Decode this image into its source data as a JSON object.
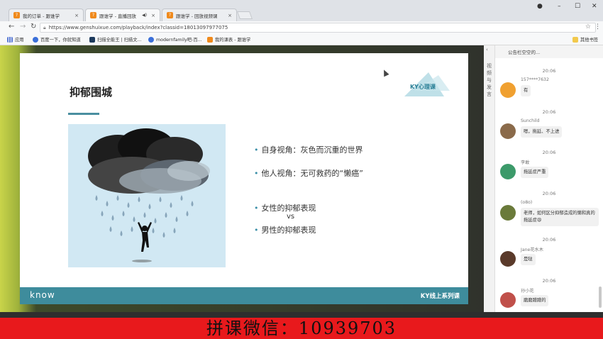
{
  "browser": {
    "tabs": [
      {
        "title": "我的订单 - 跟谁学",
        "active": false
      },
      {
        "title": "跟谁学 - 直播回放",
        "active": true
      },
      {
        "title": "跟谁学 - 回放视频课",
        "active": false
      }
    ],
    "url": "https://www.genshuixue.com/playback/index?classid=18013097977075",
    "bookmarks": [
      {
        "label": "应用",
        "icon": "apps-grid-icon"
      },
      {
        "label": "百度一下，你就知道",
        "icon": "paw-icon"
      },
      {
        "label": "扫描全能王 | 扫描文...",
        "icon": "cs-icon"
      },
      {
        "label": "modernfamily吧-百...",
        "icon": "paw-icon"
      },
      {
        "label": "我的课表 - 跟谁学",
        "icon": "gsx-icon"
      }
    ],
    "other_bookmarks": "其他书签"
  },
  "slide": {
    "title": "抑郁围城",
    "badge": "KY心理课",
    "bullets": [
      "自身视角：灰色而沉重的世界",
      "他人视角：无可救药的“懒癌”",
      "女性的抑郁表现",
      "男性的抑郁表现"
    ],
    "vs": "vs",
    "footer_brand": "know",
    "footer_series": "KY线上系列课",
    "colors": {
      "accent": "#3e8c9c",
      "title_line": "#4a8fa0"
    }
  },
  "side": {
    "vertical_tab": "视频与发言",
    "notice": "公告栏空空的..."
  },
  "chat": [
    {
      "time": "20:06",
      "user": "157****7632",
      "text": "有",
      "avatar_color": "#f0a030"
    },
    {
      "time": "20:06",
      "user": "Sunchild",
      "text": "嗯，拖延、不上进",
      "avatar_color": "#8a6a4a"
    },
    {
      "time": "20:06",
      "user": "李敢",
      "text": "拖延症严重",
      "avatar_color": "#3c9a6a"
    },
    {
      "time": "20:06",
      "user": "(o8o)",
      "text": "老师，如何区分抑郁造成的懒和真的拖延症😩",
      "avatar_color": "#6a7a3a"
    },
    {
      "time": "20:06",
      "user": "Jane花水木",
      "text": "是哒",
      "avatar_color": "#5a3a2a"
    },
    {
      "time": "20:06",
      "user": "孙小花",
      "text": "磨磨蹭蹭的",
      "avatar_color": "#c0504a"
    }
  ],
  "banner": {
    "text": "拼课微信：10939703",
    "color": "#e8191c"
  }
}
